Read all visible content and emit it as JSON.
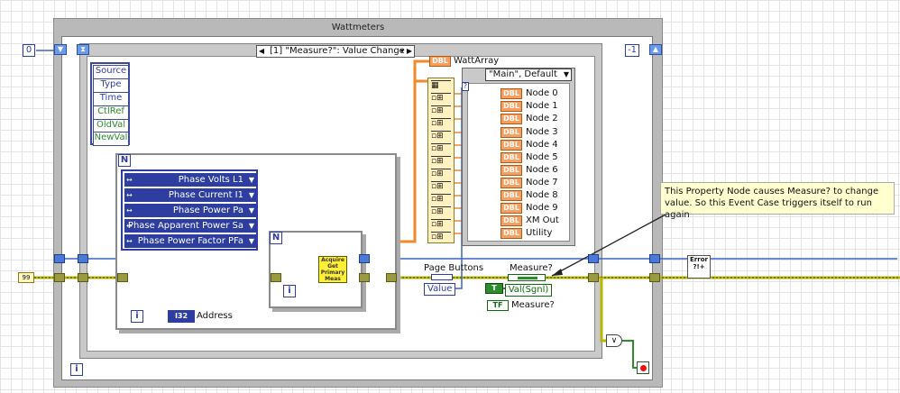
{
  "while_loop": {
    "title": "Wattmeters"
  },
  "constants": {
    "left_zero": "0",
    "right_minus_one": "-1"
  },
  "event_structure": {
    "selector": "[1] \"Measure?\": Value Change",
    "event_data": [
      "Source",
      "Type",
      "Time",
      "CtlRef",
      "OldVal",
      "NewVal"
    ]
  },
  "for_loop": {
    "count_terminal": "N",
    "iteration_terminal": "i",
    "parameters": [
      "Phase Volts L1",
      "Phase Current I1",
      "Phase Power Pa",
      "Phase Apparent Power Sa",
      "Phase Power Factor PFa"
    ],
    "address_terminal": {
      "type": "I32",
      "label": "Address"
    }
  },
  "inner_for_loop": {
    "count_terminal": "N",
    "iteration_terminal": "i"
  },
  "subvi": {
    "text": "Acquire Get Primary Meas"
  },
  "watt_array": {
    "type": "DBL",
    "label": "WattArray"
  },
  "case_structure": {
    "selector": "\"Main\", Default",
    "nodes": [
      "Node 0",
      "Node 1",
      "Node 2",
      "Node 3",
      "Node 4",
      "Node 5",
      "Node 6",
      "Node 7",
      "Node 8",
      "Node 9",
      "XM Out",
      "Utility"
    ],
    "indicator_type": "DBL"
  },
  "page_buttons": {
    "label": "Page Buttons",
    "property": "Value"
  },
  "measure_property": {
    "label": "Measure?",
    "property": "Val(Sgnl)"
  },
  "measure_terminal": {
    "type": "TF",
    "label": "Measure?"
  },
  "comment": {
    "text": "This Property Node causes Measure? to change value. So this Event Case triggers itself to run again"
  },
  "error_out": {
    "text": "Error ?!+"
  },
  "colors": {
    "wire_blue": "#3a63cc",
    "wire_orange": "#f08a2a",
    "wire_yellow": "#cccc00",
    "wire_green": "#2e8b2e"
  }
}
